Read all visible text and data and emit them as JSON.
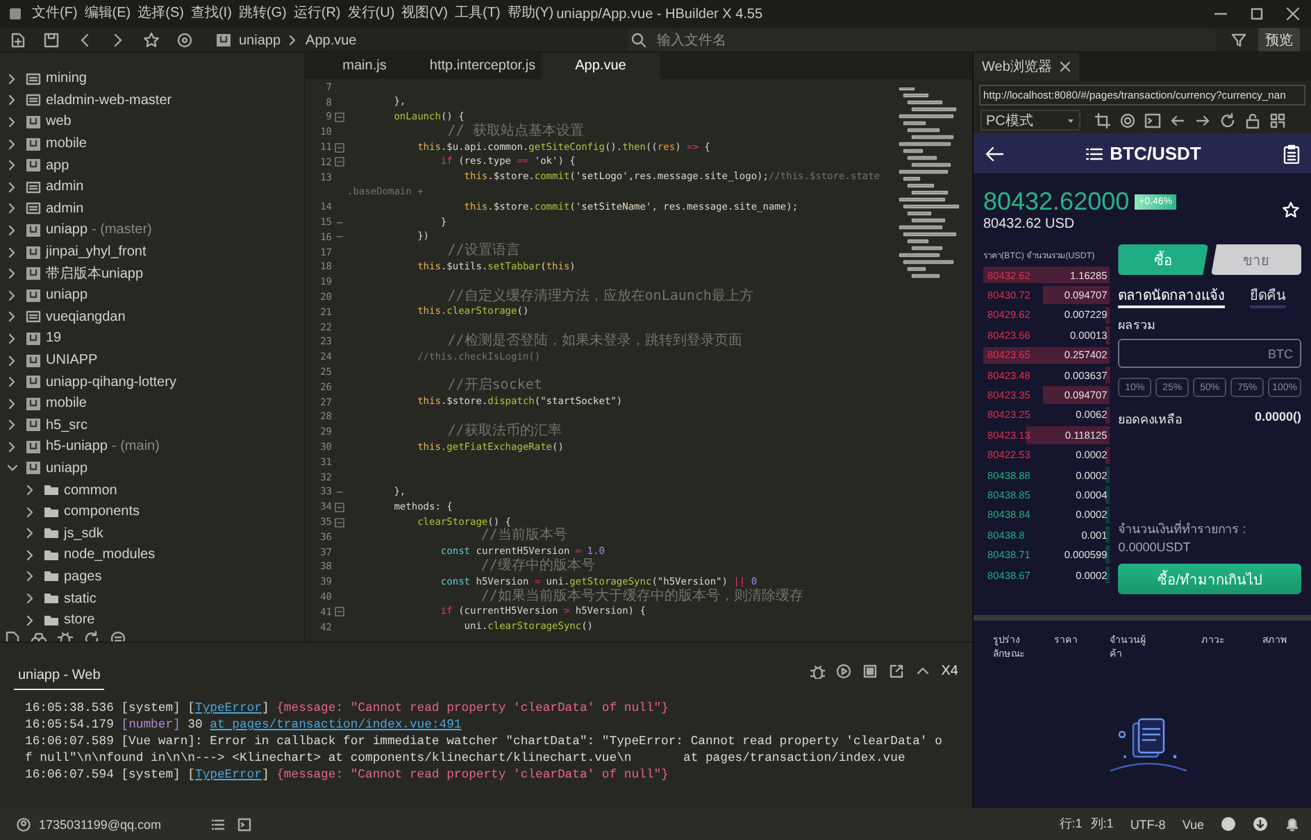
{
  "window": {
    "title": "uniapp/App.vue - HBuilder X 4.55"
  },
  "menu": [
    "文件(F)",
    "编辑(E)",
    "选择(S)",
    "查找(I)",
    "跳转(G)",
    "运行(R)",
    "发行(U)",
    "视图(V)",
    "工具(T)",
    "帮助(Y)"
  ],
  "toolbar": {
    "breadcrumb": [
      "uniapp",
      "App.vue"
    ],
    "search": {
      "placeholder": "输入文件名"
    },
    "preview_button": "预览"
  },
  "sidebar": {
    "items": [
      {
        "label": "mining",
        "kind": "web",
        "expanded": false
      },
      {
        "label": "eladmin-web-master",
        "kind": "web",
        "expanded": false
      },
      {
        "label": "web",
        "kind": "uni",
        "expanded": false
      },
      {
        "label": "mobile",
        "kind": "uni",
        "expanded": false
      },
      {
        "label": "app",
        "kind": "uni",
        "expanded": false
      },
      {
        "label": "admin",
        "kind": "web",
        "expanded": false
      },
      {
        "label": "admin",
        "kind": "web",
        "expanded": false
      },
      {
        "label": "uniapp",
        "kind": "uni",
        "expanded": false,
        "suffix": "- (master)"
      },
      {
        "label": "jinpai_yhyl_front",
        "kind": "uni",
        "expanded": false
      },
      {
        "label": "带启版本uniapp",
        "kind": "uni",
        "expanded": false
      },
      {
        "label": "uniapp",
        "kind": "uni",
        "expanded": false
      },
      {
        "label": "vueqiangdan",
        "kind": "web",
        "expanded": false
      },
      {
        "label": "19",
        "kind": "uni",
        "expanded": false
      },
      {
        "label": "UNIAPP",
        "kind": "uni",
        "expanded": false
      },
      {
        "label": "uniapp-qihang-lottery",
        "kind": "uni",
        "expanded": false
      },
      {
        "label": "mobile",
        "kind": "uni",
        "expanded": false
      },
      {
        "label": "h5_src",
        "kind": "uni",
        "expanded": false
      },
      {
        "label": "h5-uniapp",
        "kind": "uni",
        "expanded": false,
        "suffix": "- (main)"
      },
      {
        "label": "uniapp",
        "kind": "uni",
        "expanded": true,
        "children": [
          {
            "label": "common",
            "kind": "folder",
            "expanded": false
          },
          {
            "label": "components",
            "kind": "folder",
            "expanded": false
          },
          {
            "label": "js_sdk",
            "kind": "folder",
            "expanded": false
          },
          {
            "label": "node_modules",
            "kind": "folder",
            "expanded": false
          },
          {
            "label": "pages",
            "kind": "folder",
            "expanded": false
          },
          {
            "label": "static",
            "kind": "folder",
            "expanded": false
          },
          {
            "label": "store",
            "kind": "folder",
            "expanded": false
          }
        ]
      }
    ]
  },
  "editor": {
    "tabs": [
      {
        "label": "main.js",
        "selected": false
      },
      {
        "label": "http.interceptor.js",
        "selected": false
      },
      {
        "label": "App.vue",
        "selected": true
      }
    ],
    "lines": [
      {
        "num": "7",
        "kind": "plain"
      },
      {
        "num": "8",
        "kind": "plain",
        "tokens": [
          {
            "kind": "plain",
            "text": "        },"
          }
        ]
      },
      {
        "num": "9",
        "kind": "fold_start",
        "tokens": [
          {
            "kind": "function",
            "text": "        onLaunch"
          },
          {
            "kind": "plain",
            "text": "() {"
          }
        ]
      },
      {
        "num": "10",
        "kind": "plain",
        "tokens": [
          {
            "kind": "comment_cjk",
            "text": "            // 获取站点基本设置"
          }
        ]
      },
      {
        "num": "11",
        "kind": "fold_start",
        "tokens": [
          {
            "kind": "this",
            "text": "            this"
          },
          {
            "kind": "plain",
            "text": ".$u.api.common."
          },
          {
            "kind": "function",
            "text": "getSiteConfig"
          },
          {
            "kind": "plain",
            "text": "()."
          },
          {
            "kind": "function",
            "text": "then"
          },
          {
            "kind": "plain",
            "text": "(("
          },
          {
            "kind": "param",
            "text": "res"
          },
          {
            "kind": "plain",
            "text": ") "
          },
          {
            "kind": "operator",
            "text": "=>"
          },
          {
            "kind": "plain",
            "text": " {"
          }
        ]
      },
      {
        "num": "12",
        "kind": "fold_start",
        "tokens": [
          {
            "kind": "keyword",
            "text": "                if"
          },
          {
            "kind": "plain",
            "text": " (res.type "
          },
          {
            "kind": "operator",
            "text": "=="
          },
          {
            "kind": "string",
            "text": " 'ok'"
          },
          {
            "kind": "plain",
            "text": ") {"
          }
        ]
      },
      {
        "num": "13",
        "kind": "plain",
        "tokens": [
          {
            "kind": "this",
            "text": "                    this"
          },
          {
            "kind": "plain",
            "text": ".$store."
          },
          {
            "kind": "function",
            "text": "commit"
          },
          {
            "kind": "plain",
            "text": "("
          },
          {
            "kind": "string",
            "text": "'setLogo'"
          },
          {
            "kind": "plain",
            "text": ",res.message.site_logo);"
          },
          {
            "kind": "comment",
            "text": "//this.$store.state"
          }
        ]
      },
      {
        "kind": "plain",
        "tokens": [
          {
            "kind": "comment",
            "text": ".baseDomain +"
          }
        ]
      },
      {
        "num": "14",
        "kind": "plain",
        "tokens": [
          {
            "kind": "this",
            "text": "                    this"
          },
          {
            "kind": "plain",
            "text": ".$store."
          },
          {
            "kind": "function",
            "text": "commit"
          },
          {
            "kind": "plain",
            "text": "("
          },
          {
            "kind": "string",
            "text": "'setSiteName'"
          },
          {
            "kind": "plain",
            "text": ", res.message.site_name);"
          }
        ]
      },
      {
        "num": "15",
        "kind": "fold_end",
        "tokens": [
          {
            "kind": "plain",
            "text": "                }"
          }
        ]
      },
      {
        "num": "16",
        "kind": "fold_end",
        "tokens": [
          {
            "kind": "plain",
            "text": "            })"
          }
        ]
      },
      {
        "num": "17",
        "kind": "plain",
        "tokens": [
          {
            "kind": "comment_cjk",
            "text": "            //设置语言"
          }
        ]
      },
      {
        "num": "18",
        "kind": "plain",
        "tokens": [
          {
            "kind": "this",
            "text": "            this"
          },
          {
            "kind": "plain",
            "text": ".$utils."
          },
          {
            "kind": "function",
            "text": "setTabbar"
          },
          {
            "kind": "plain",
            "text": "("
          },
          {
            "kind": "this",
            "text": "this"
          },
          {
            "kind": "plain",
            "text": ")"
          }
        ]
      },
      {
        "num": "19",
        "kind": "plain"
      },
      {
        "num": "20",
        "kind": "plain",
        "tokens": [
          {
            "kind": "comment_cjk",
            "text": "            //自定义缓存清理方法，应放在onLaunch最上方"
          }
        ]
      },
      {
        "num": "21",
        "kind": "plain",
        "tokens": [
          {
            "kind": "this",
            "text": "            this."
          },
          {
            "kind": "function",
            "text": "clearStorage"
          },
          {
            "kind": "plain",
            "text": "()"
          }
        ]
      },
      {
        "num": "22",
        "kind": "plain"
      },
      {
        "num": "23",
        "kind": "plain",
        "tokens": [
          {
            "kind": "comment_cjk",
            "text": "            //检测是否登陆，如果未登录，跳转到登录页面"
          }
        ]
      },
      {
        "num": "24",
        "kind": "plain",
        "tokens": [
          {
            "kind": "comment",
            "text": "            //this.checkIsLogin()"
          }
        ]
      },
      {
        "num": "25",
        "kind": "plain"
      },
      {
        "num": "26",
        "kind": "plain",
        "tokens": [
          {
            "kind": "comment_cjk",
            "text": "            //开启socket"
          }
        ]
      },
      {
        "num": "27",
        "kind": "plain",
        "tokens": [
          {
            "kind": "this",
            "text": "            this"
          },
          {
            "kind": "plain",
            "text": ".$store."
          },
          {
            "kind": "function",
            "text": "dispatch"
          },
          {
            "kind": "plain",
            "text": "("
          },
          {
            "kind": "string",
            "text": "\"startSocket\""
          },
          {
            "kind": "plain",
            "text": ")"
          }
        ]
      },
      {
        "num": "28",
        "kind": "plain"
      },
      {
        "num": "29",
        "kind": "plain",
        "tokens": [
          {
            "kind": "comment_cjk",
            "text": "            //获取法币的汇率"
          }
        ]
      },
      {
        "num": "30",
        "kind": "plain",
        "tokens": [
          {
            "kind": "this",
            "text": "            this."
          },
          {
            "kind": "function",
            "text": "getFiatExchageRate"
          },
          {
            "kind": "plain",
            "text": "()"
          }
        ]
      },
      {
        "num": "31",
        "kind": "plain"
      },
      {
        "num": "32",
        "kind": "plain"
      },
      {
        "num": "33",
        "kind": "fold_end",
        "tokens": [
          {
            "kind": "plain",
            "text": "        },"
          }
        ]
      },
      {
        "num": "34",
        "kind": "fold_start",
        "tokens": [
          {
            "kind": "plain",
            "text": "        methods: {"
          }
        ]
      },
      {
        "num": "35",
        "kind": "fold_start",
        "tokens": [
          {
            "kind": "function",
            "text": "            clearStorage"
          },
          {
            "kind": "plain",
            "text": "() {"
          }
        ]
      },
      {
        "num": "36",
        "kind": "plain",
        "tokens": [
          {
            "kind": "comment_cjk",
            "text": "                //当前版本号"
          }
        ]
      },
      {
        "num": "37",
        "kind": "plain",
        "tokens": [
          {
            "kind": "declaration",
            "text": "                const"
          },
          {
            "kind": "plain",
            "text": " currentH5Version "
          },
          {
            "kind": "operator",
            "text": "="
          },
          {
            "kind": "number",
            "text": " 1.0"
          }
        ]
      },
      {
        "num": "38",
        "kind": "plain",
        "tokens": [
          {
            "kind": "comment_cjk",
            "text": "                //缓存中的版本号"
          }
        ]
      },
      {
        "num": "39",
        "kind": "plain",
        "tokens": [
          {
            "kind": "declaration",
            "text": "                const"
          },
          {
            "kind": "plain",
            "text": " h5Version "
          },
          {
            "kind": "operator",
            "text": "="
          },
          {
            "kind": "plain",
            "text": " uni."
          },
          {
            "kind": "function",
            "text": "getStorageSync"
          },
          {
            "kind": "plain",
            "text": "("
          },
          {
            "kind": "string",
            "text": "\"h5Version\""
          },
          {
            "kind": "plain",
            "text": ") "
          },
          {
            "kind": "operator",
            "text": "||"
          },
          {
            "kind": "number",
            "text": " 0"
          }
        ]
      },
      {
        "num": "40",
        "kind": "plain",
        "tokens": [
          {
            "kind": "comment_cjk",
            "text": "                //如果当前版本号大于缓存中的版本号，则清除缓存"
          }
        ]
      },
      {
        "num": "41",
        "kind": "fold_start",
        "tokens": [
          {
            "kind": "keyword",
            "text": "                if"
          },
          {
            "kind": "plain",
            "text": " (currentH5Version "
          },
          {
            "kind": "operator",
            "text": ">"
          },
          {
            "kind": "plain",
            "text": " h5Version) {"
          }
        ]
      },
      {
        "num": "42",
        "kind": "plain",
        "tokens": [
          {
            "kind": "plain",
            "text": "                    uni."
          },
          {
            "kind": "function",
            "text": "clearStorageSync"
          },
          {
            "kind": "plain",
            "text": "()"
          }
        ]
      }
    ]
  },
  "browser": {
    "tab": "Web浏览器",
    "url": "http://localhost:8080/#/pages/transaction/currency?currency_nan",
    "mode": "PC模式",
    "app": {
      "pair": "BTC/USDT",
      "price": "80432.62000",
      "change": "+0.46%",
      "price_usd": "80432.62 USD",
      "book_header": "ราคา(BTC) จำนวนรวม(USDT)",
      "book": [
        {
          "price": "80432.62",
          "amount": "1.16285",
          "kind": "ask"
        },
        {
          "price": "80430.72",
          "amount": "0.094707",
          "kind": "ask"
        },
        {
          "price": "80429.62",
          "amount": "0.007229",
          "kind": "ask"
        },
        {
          "price": "80423.66",
          "amount": "0.00013",
          "kind": "ask"
        },
        {
          "price": "80423.65",
          "amount": "0.257402",
          "kind": "ask"
        },
        {
          "price": "80423.48",
          "amount": "0.003637",
          "kind": "ask"
        },
        {
          "price": "80423.35",
          "amount": "0.094707",
          "kind": "ask"
        },
        {
          "price": "80423.25",
          "amount": "0.0062",
          "kind": "ask"
        },
        {
          "price": "80423.13",
          "amount": "0.118125",
          "kind": "ask"
        },
        {
          "price": "80422.53",
          "amount": "0.0002",
          "kind": "ask"
        },
        {
          "price": "80438.88",
          "amount": "0.0002",
          "kind": "bid"
        },
        {
          "price": "80438.85",
          "amount": "0.0004",
          "kind": "bid"
        },
        {
          "price": "80438.84",
          "amount": "0.0002",
          "kind": "bid"
        },
        {
          "price": "80438.8",
          "amount": "0.001",
          "kind": "bid"
        },
        {
          "price": "80438.71",
          "amount": "0.000599",
          "kind": "bid"
        },
        {
          "price": "80438.67",
          "amount": "0.0002",
          "kind": "bid"
        }
      ],
      "sides": [
        {
          "label": "ซื้อ",
          "selected": true
        },
        {
          "label": "ขาย",
          "selected": false
        }
      ],
      "order_tabs": [
        {
          "label": "ตลาดนัดกลางแจ้ง",
          "selected": true
        },
        {
          "label": "ยืดคืน",
          "selected": false
        }
      ],
      "total_label": "ผลรวม",
      "amount_field": {
        "placeholder": "BTC"
      },
      "percents": [
        "10%",
        "25%",
        "50%",
        "75%",
        "100%"
      ],
      "balance_label": "ยอดคงเหลือ",
      "balance": "0.0000()",
      "turnover_label": "จำนวนเงินที่ทำรายการ :",
      "turnover": "0.0000USDT",
      "submit": "ซื้อ/ทำมากเกินไป",
      "orders_columns": [
        "รูปร่าง ลักษณะ",
        "ราคา",
        "จำนวนผู้ค้า",
        "ภาวะ",
        "สภาพ"
      ]
    }
  },
  "console": {
    "tab": "uniapp - Web",
    "clear_label": "X4",
    "logs": [
      {
        "spans": [
          {
            "kind": "plain",
            "text": "16:05:38.536 [system] ["
          },
          {
            "kind": "link",
            "text": "TypeError"
          },
          {
            "kind": "plain",
            "text": "] "
          },
          {
            "kind": "error",
            "text": "{message: \"Cannot read property 'clearData' of null\"}"
          }
        ]
      },
      {
        "spans": [
          {
            "kind": "plain",
            "text": "16:05:54.179 "
          },
          {
            "kind": "number",
            "text": "[number]"
          },
          {
            "kind": "plain",
            "text": " 30 "
          },
          {
            "kind": "link",
            "text": "at pages/transaction/index.vue:491"
          }
        ]
      },
      {
        "spans": [
          {
            "kind": "plain",
            "text": "16:06:07.589 [Vue warn]: Error in callback for immediate watcher \"chartData\": \"TypeError: Cannot read property 'clearData' o"
          }
        ]
      },
      {
        "spans": [
          {
            "kind": "plain",
            "text": "f null\"\\n\\nfound in\\n\\n---> <Klinechart> at components/klinechart/klinechart.vue\\n       at pages/transaction/index.vue"
          }
        ]
      },
      {
        "spans": [
          {
            "kind": "plain",
            "text": "16:06:07.594 [system] ["
          },
          {
            "kind": "link",
            "text": "TypeError"
          },
          {
            "kind": "plain",
            "text": "] "
          },
          {
            "kind": "error",
            "text": "{message: \"Cannot read property 'clearData' of null\"}"
          }
        ]
      }
    ]
  },
  "status_bar": {
    "user": "1735031199@qq.com",
    "line": "行:1",
    "column": "列:1",
    "encoding": "UTF-8",
    "language": "Vue"
  }
}
